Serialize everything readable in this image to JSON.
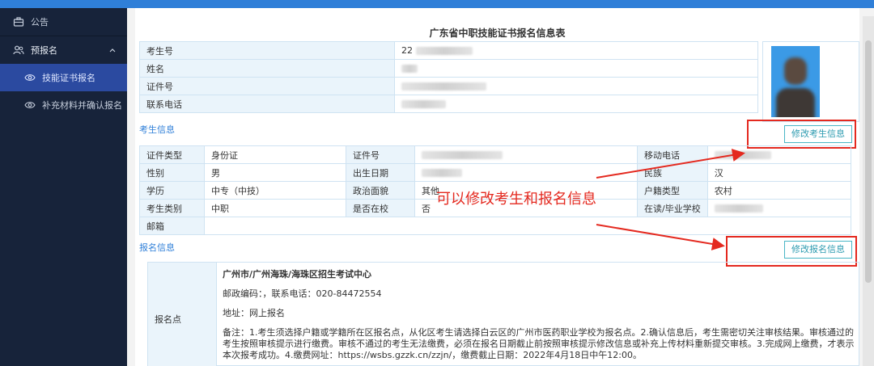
{
  "sidebar": {
    "items": [
      {
        "label": "公告",
        "icon": "briefcase-icon"
      },
      {
        "label": "预报名",
        "icon": "users-icon"
      },
      {
        "label": "技能证书报名",
        "icon": "eye-icon"
      },
      {
        "label": "补充材料并确认报名",
        "icon": "eye-icon"
      }
    ]
  },
  "form": {
    "title": "广东省中职技能证书报名信息表",
    "top_rows": [
      {
        "label": "考生号",
        "value": "22"
      },
      {
        "label": "姓名",
        "value": ""
      },
      {
        "label": "证件号",
        "value": ""
      },
      {
        "label": "联系电话",
        "value": ""
      }
    ],
    "candidate_section": "考生信息",
    "edit_candidate_btn": "修改考生信息",
    "candidate": {
      "id_type_label": "证件类型",
      "id_type": "身份证",
      "id_no_label": "证件号",
      "mobile_label": "移动电话",
      "gender_label": "性别",
      "gender": "男",
      "birth_label": "出生日期",
      "ethnic_label": "民族",
      "ethnic": "汉",
      "edu_label": "学历",
      "edu": "中专（中技）",
      "politics_label": "政治面貌",
      "politics": "其他",
      "huji_label": "户籍类型",
      "huji": "农村",
      "cat_label": "考生类别",
      "cat": "中职",
      "inschool_label": "是否在校",
      "inschool": "否",
      "school_label": "在读/毕业学校",
      "email_label": "邮箱"
    },
    "reg_section": "报名信息",
    "edit_reg_btn": "修改报名信息",
    "reg_label": "报名点",
    "reg": {
      "center": "广州市/广州海珠/海珠区招生考试中心",
      "contact": "邮政编码：，联系电话：020-84472554",
      "address": "地址：网上报名",
      "note": "备注：1.考生须选择户籍或学籍所在区报名点，从化区考生请选择白云区的广州市医药职业学校为报名点。2.确认信息后，考生需密切关注审核结果。审核通过的考生按照审核提示进行缴费。审核不通过的考生无法缴费，必须在报名日期截止前按照审核提示修改信息或补充上传材料重新提交审核。3.完成网上缴费，才表示本次报考成功。4.缴费网址：https://wsbs.gzzk.cn/zzjn/，缴费截止日期：2022年4月18日中午12:00。"
    }
  },
  "annotation": {
    "text": "可以修改考生和报名信息",
    "color": "#e4291f"
  },
  "colors": {
    "sidebar_bg": "#17233a",
    "active_bg": "#2b4aa0",
    "accent": "#2f7fd8",
    "button": "#2d9bb0",
    "table_border": "#cfe3f2"
  }
}
